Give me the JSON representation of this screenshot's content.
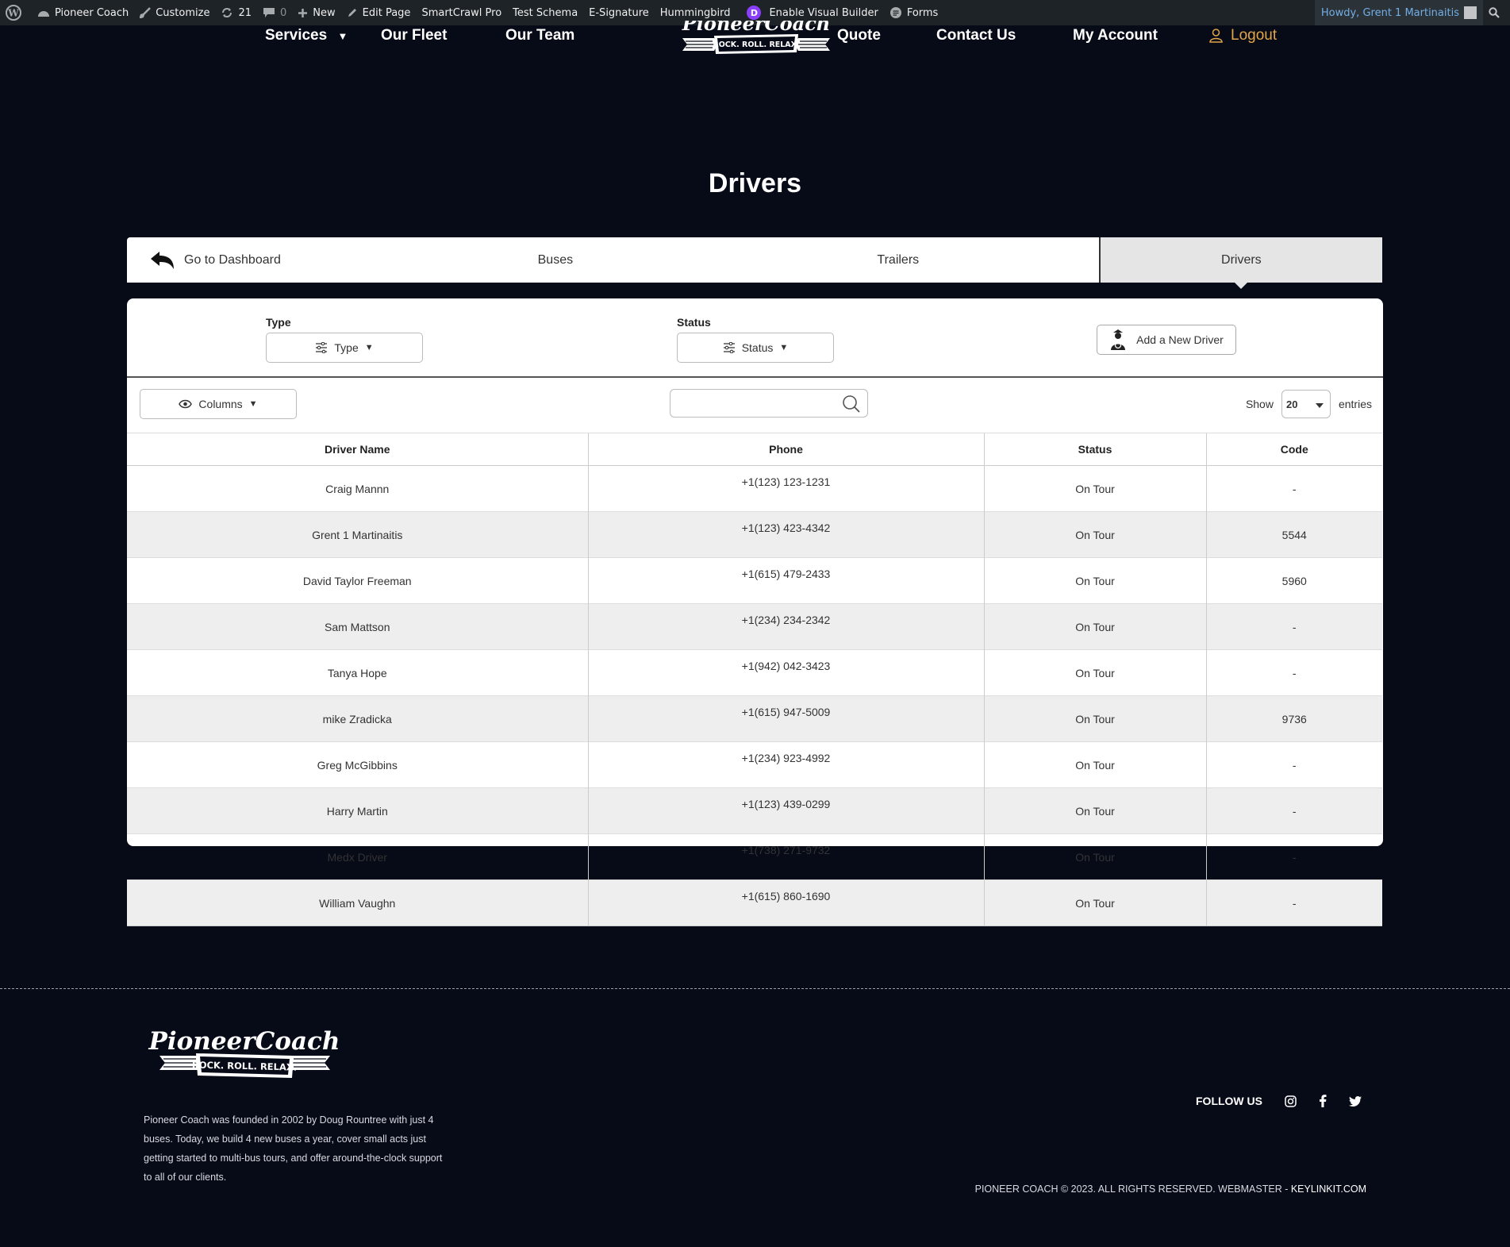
{
  "adminbar": {
    "site_name": "Pioneer Coach",
    "customize": "Customize",
    "updates_count": "21",
    "comments_count": "0",
    "new": "New",
    "edit_page": "Edit Page",
    "smartcrawl": "SmartCrawl Pro",
    "test_schema": "Test Schema",
    "esignature": "E-Signature",
    "hummingbird": "Hummingbird",
    "visual_builder": "Enable Visual Builder",
    "forms": "Forms",
    "howdy": "Howdy, Grent 1 Martinaitis"
  },
  "nav": {
    "services": "Services",
    "fleet": "Our Fleet",
    "team": "Our Team",
    "quote": "Quote",
    "contact": "Contact Us",
    "account": "My Account",
    "logout": "Logout"
  },
  "page": {
    "title": "Drivers"
  },
  "tabs": {
    "back": "Go to Dashboard",
    "buses": "Buses",
    "trailers": "Trailers",
    "drivers": "Drivers"
  },
  "filters": {
    "type_label": "Type",
    "type_value": "Type",
    "status_label": "Status",
    "status_value": "Status",
    "add_driver": "Add a New Driver",
    "columns": "Columns",
    "search_placeholder": "",
    "show": "Show",
    "entries_value": "20",
    "entries": "entries"
  },
  "table": {
    "headers": [
      "Driver Name",
      "Phone",
      "Status",
      "Code"
    ],
    "rows": [
      [
        "Craig Mannn",
        "+1(123) 123-1231",
        "On Tour",
        "-"
      ],
      [
        "Grent 1 Martinaitis",
        "+1(123) 423-4342",
        "On Tour",
        "5544"
      ],
      [
        "David Taylor Freeman",
        "+1(615) 479-2433",
        "On Tour",
        "5960"
      ],
      [
        "Sam Mattson",
        "+1(234) 234-2342",
        "On Tour",
        "-"
      ],
      [
        "Tanya Hope",
        "+1(942) 042-3423",
        "On Tour",
        "-"
      ],
      [
        "mike Zradicka",
        "+1(615) 947-5009",
        "On Tour",
        "9736"
      ],
      [
        "Greg McGibbins",
        "+1(234) 923-4992",
        "On Tour",
        "-"
      ],
      [
        "Harry Martin",
        "+1(123) 439-0299",
        "On Tour",
        "-"
      ],
      [
        "Medx Driver",
        "+1(738) 271-9732",
        "On Tour",
        "-"
      ],
      [
        "William Vaughn",
        "+1(615) 860-1690",
        "On Tour",
        "-"
      ]
    ]
  },
  "footer": {
    "logo_text": "PioneerCoach",
    "logo_tagline": "ROCK. ROLL. RELAX.",
    "about": "Pioneer Coach was founded in 2002 by Doug Rountree with just 4 buses. Today, we build 4 new buses a year, cover small acts just getting started to multi-bus tours, and offer around-the-clock support to all of our clients.",
    "follow_us": "FOLLOW US",
    "copyright": "PIONEER COACH © 2023. ALL RIGHTS RESERVED. WEBMASTER - ",
    "webmaster": "KEYLINKIT.COM"
  },
  "colors": {
    "background": "#070b18",
    "adminbar": "#1d2327",
    "logout_accent": "#e0a647",
    "active_tab": "#e5e5e5",
    "row_stripe": "#eeeeee"
  }
}
